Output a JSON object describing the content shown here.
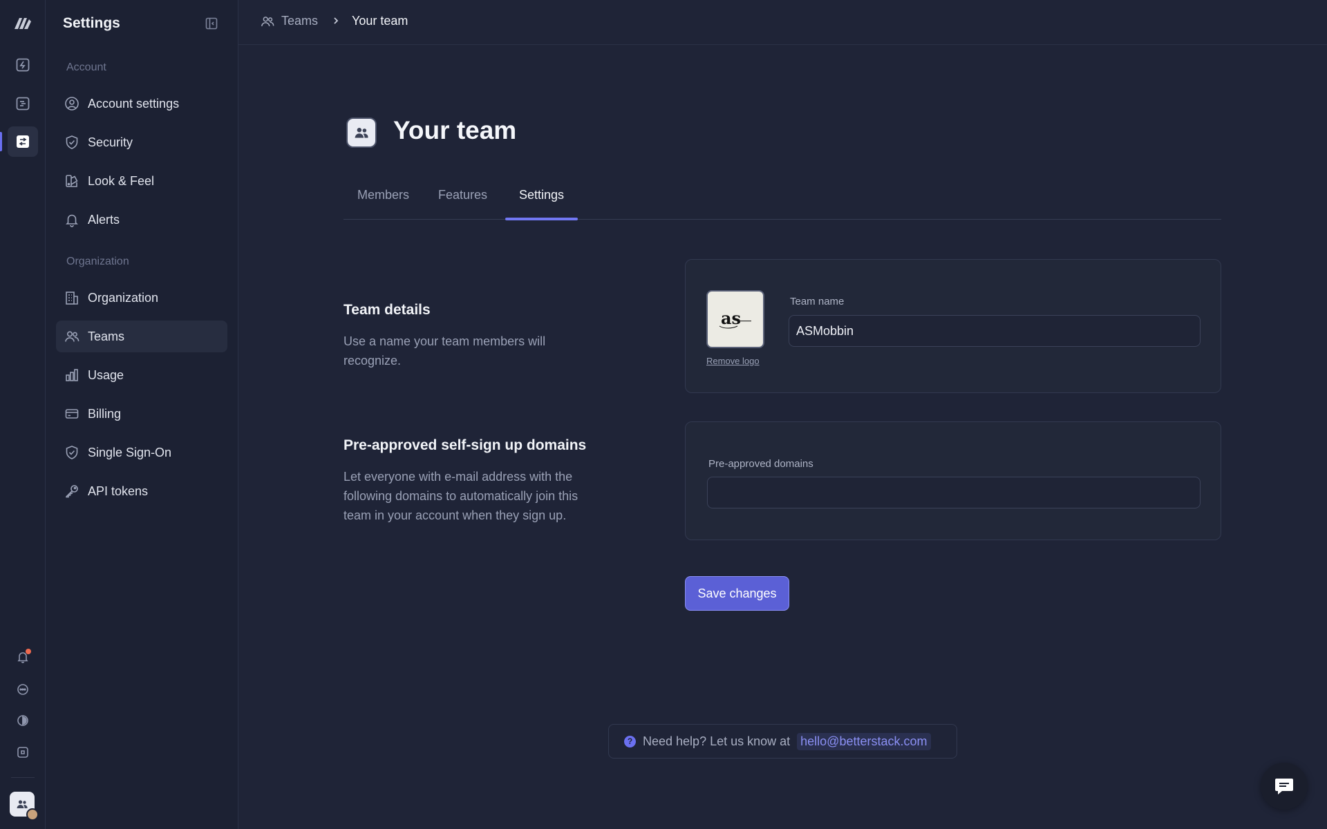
{
  "sidebar": {
    "title": "Settings",
    "sections": {
      "account": "Account",
      "organization": "Organization"
    },
    "items": [
      {
        "label": "Account settings",
        "icon": "user-circle-icon"
      },
      {
        "label": "Security",
        "icon": "shield-icon"
      },
      {
        "label": "Look & Feel",
        "icon": "palette-icon"
      },
      {
        "label": "Alerts",
        "icon": "bell-icon"
      },
      {
        "label": "Organization",
        "icon": "building-icon"
      },
      {
        "label": "Teams",
        "icon": "users-icon",
        "active": true
      },
      {
        "label": "Usage",
        "icon": "bar-chart-icon"
      },
      {
        "label": "Billing",
        "icon": "credit-card-icon"
      },
      {
        "label": "Single Sign-On",
        "icon": "shield-check-icon"
      },
      {
        "label": "API tokens",
        "icon": "key-icon"
      }
    ]
  },
  "breadcrumb": {
    "parent": "Teams",
    "current": "Your team"
  },
  "page": {
    "title": "Your team",
    "tabs": [
      "Members",
      "Features",
      "Settings"
    ],
    "active_tab": "Settings"
  },
  "team_details": {
    "title": "Team details",
    "description": "Use a name your team members will recognize.",
    "remove_logo": "Remove logo",
    "team_name_label": "Team name",
    "team_name_value": "ASMobbin"
  },
  "domains": {
    "title": "Pre-approved self-sign up domains",
    "description": "Let everyone with e-mail address with the following domains to automatically join this team in your account when they sign up.",
    "field_label": "Pre-approved domains",
    "field_value": ""
  },
  "actions": {
    "save_label": "Save changes"
  },
  "help": {
    "text": "Need help? Let us know at",
    "email": "hello@betterstack.com"
  },
  "colors": {
    "background": "#1f2437",
    "accent": "#5b60d6",
    "notification": "#ef6a4f"
  }
}
